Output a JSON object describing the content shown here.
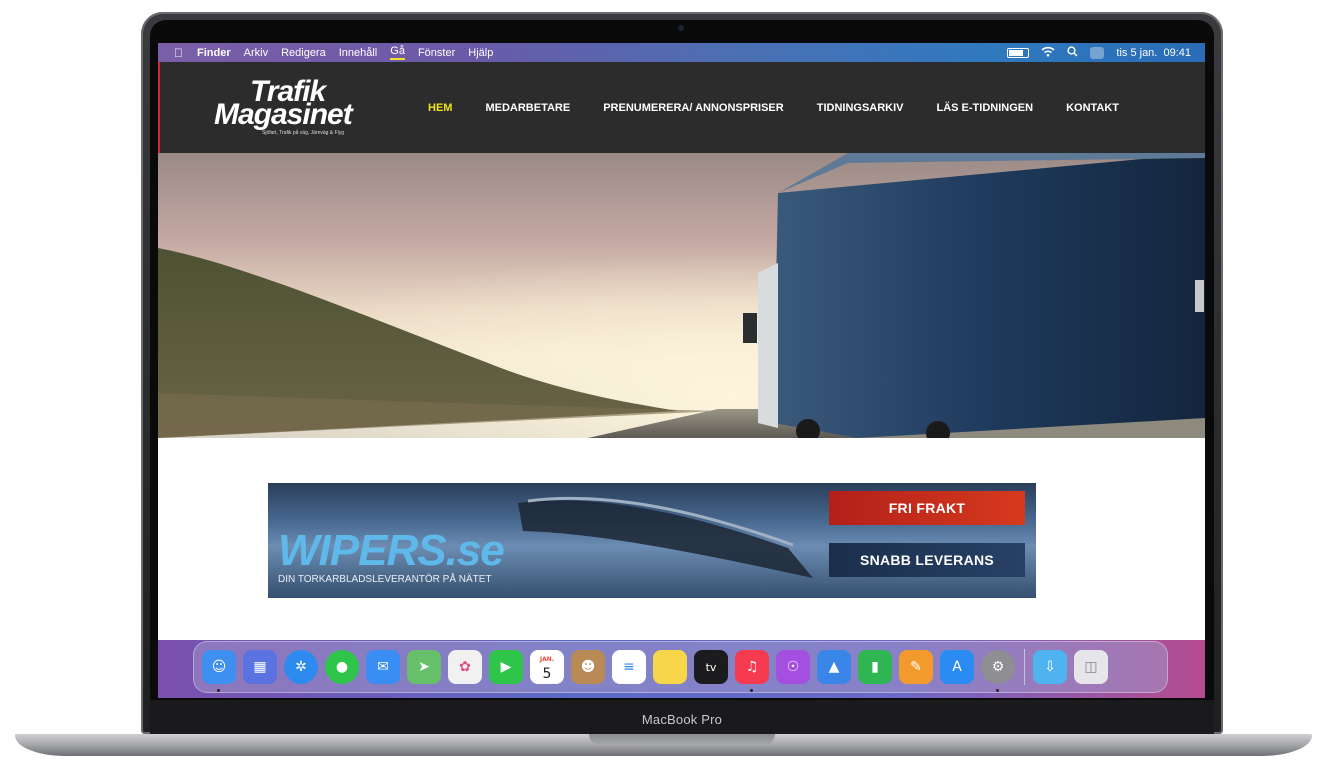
{
  "device": {
    "label": "MacBook Pro"
  },
  "menubar": {
    "app_name": "Finder",
    "items": [
      "Arkiv",
      "Redigera",
      "Innehåll",
      "Gå",
      "Fönster",
      "Hjälp"
    ],
    "active_item": "Gå",
    "clock": "tis 5 jan.  09:41",
    "icons": [
      "apple-logo",
      "battery-icon",
      "wifi-icon",
      "spotlight-icon",
      "control-center-icon"
    ]
  },
  "site": {
    "logo_line1": "Trafik",
    "logo_line2": "Magasinet",
    "logo_tagline": "Sjöfart, Trafik på väg, Järnväg & Flyg",
    "nav": [
      {
        "label": "HEM",
        "active": true
      },
      {
        "label": "MEDARBETARE",
        "active": false
      },
      {
        "label": "PRENUMERERA/ ANNONSPRISER",
        "active": false
      },
      {
        "label": "TIDNINGSARKIV",
        "active": false
      },
      {
        "label": "LÄS E-TIDNINGEN",
        "active": false
      },
      {
        "label": "KONTAKT",
        "active": false
      }
    ],
    "colors": {
      "nav_active": "#f2e21c",
      "header_bg": "#2c2c2c"
    }
  },
  "banner": {
    "brand": "WIPERS.se",
    "tagline": "DIN TORKARBLADSLEVERANTÖR PÅ NÄTET",
    "ribbon_1": "FRI FRAKT",
    "ribbon_2": "SNABB LEVERANS"
  },
  "dock": {
    "calendar_month": "JAN.",
    "calendar_day": "5",
    "tv_label": "tv",
    "apps": [
      {
        "name": "Finder",
        "icon": "finder-icon",
        "color": "#3d8ff0",
        "running": true
      },
      {
        "name": "Launchpad",
        "icon": "launchpad-icon",
        "color": "#5a73e0",
        "running": false
      },
      {
        "name": "Safari",
        "icon": "safari-icon",
        "color": "#2d8bf0",
        "running": false
      },
      {
        "name": "Messages",
        "icon": "messages-icon",
        "color": "#2fc54a",
        "running": false
      },
      {
        "name": "Mail",
        "icon": "mail-icon",
        "color": "#3a8ef3",
        "running": false
      },
      {
        "name": "Maps",
        "icon": "maps-icon",
        "color": "#67c06a",
        "running": false
      },
      {
        "name": "Photos",
        "icon": "photos-icon",
        "color": "#f1f1f1",
        "running": false
      },
      {
        "name": "FaceTime",
        "icon": "facetime-icon",
        "color": "#2fc54a",
        "running": false
      },
      {
        "name": "Calendar",
        "icon": "calendar-icon",
        "color": "#ffffff",
        "running": false
      },
      {
        "name": "Contacts",
        "icon": "contacts-icon",
        "color": "#b98a55",
        "running": false
      },
      {
        "name": "Reminders",
        "icon": "reminders-icon",
        "color": "#ffffff",
        "running": false
      },
      {
        "name": "Notes",
        "icon": "notes-icon",
        "color": "#f7d649",
        "running": false
      },
      {
        "name": "Apple TV",
        "icon": "appletv-icon",
        "color": "#1c1c1e",
        "running": false
      },
      {
        "name": "Music",
        "icon": "music-icon",
        "color": "#f63a4f",
        "running": true
      },
      {
        "name": "Podcasts",
        "icon": "podcasts-icon",
        "color": "#a54fe0",
        "running": false
      },
      {
        "name": "Keynote",
        "icon": "keynote-icon",
        "color": "#3a86e8",
        "running": false
      },
      {
        "name": "Numbers",
        "icon": "numbers-icon",
        "color": "#2fb653",
        "running": false
      },
      {
        "name": "Pages",
        "icon": "pages-icon",
        "color": "#f29b2c",
        "running": false
      },
      {
        "name": "App Store",
        "icon": "appstore-icon",
        "color": "#2a8bf2",
        "running": false
      },
      {
        "name": "System Preferences",
        "icon": "system-preferences-icon",
        "color": "#8e8e93",
        "running": true
      }
    ],
    "downloads": {
      "icon": "downloads-folder-icon",
      "color": "#4fb3f0"
    },
    "trash": {
      "icon": "trash-icon",
      "color": "#e6e6ea"
    }
  }
}
